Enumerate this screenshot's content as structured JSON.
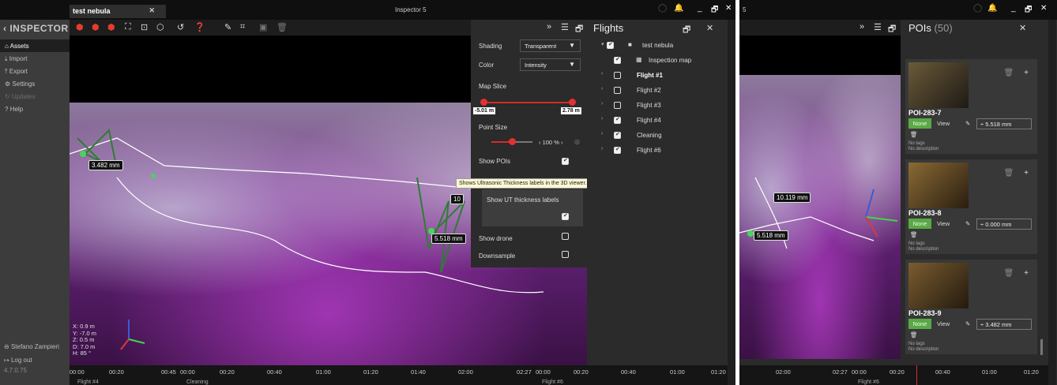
{
  "left_window": {
    "tab": "test nebula",
    "title": "Inspector 5",
    "sidebar": {
      "logo": "INSPECTOR",
      "items": [
        {
          "label": "Assets",
          "icon": "home-icon",
          "active": true
        },
        {
          "label": "Import",
          "icon": "download-icon"
        },
        {
          "label": "Export",
          "icon": "upload-icon"
        },
        {
          "label": "Settings",
          "icon": "gear-icon"
        },
        {
          "label": "Updates",
          "icon": "refresh-icon",
          "dim": true
        },
        {
          "label": "Help",
          "icon": "help-icon"
        }
      ],
      "user": "Stefano Zampieri",
      "logout": "Log out",
      "version": "4.7.0.75"
    },
    "settings_panel": {
      "shading_label": "Shading",
      "shading_value": "Transparent",
      "color_label": "Color",
      "color_value": "Intensity",
      "map_slice_label": "Map Slice",
      "map_slice_min": "-5.01 m",
      "map_slice_max": "2.78 m",
      "point_size_label": "Point Size",
      "point_size_value": "100 %",
      "show_pois_label": "Show POIs",
      "show_pois": true,
      "tooltip": "Shows Ultrasonic Thickness labels in the 3D viewer.",
      "show_ut_label": "Show UT thickness labels",
      "show_ut": true,
      "show_drone_label": "Show drone",
      "show_drone": false,
      "downsample_label": "Downsample",
      "downsample": false
    },
    "flights": {
      "title": "Flights",
      "items": [
        {
          "label": "test nebula",
          "checked": true,
          "bold": false
        },
        {
          "label": "Inspection map",
          "checked": true,
          "bold": false
        },
        {
          "label": "Flight #1",
          "checked": false,
          "bold": true
        },
        {
          "label": "Flight #2",
          "checked": false,
          "bold": false
        },
        {
          "label": "Flight #3",
          "checked": false,
          "bold": false
        },
        {
          "label": "Flight #4",
          "checked": true,
          "bold": false
        },
        {
          "label": "Cleaning",
          "checked": true,
          "bold": false
        },
        {
          "label": "Flight #6",
          "checked": true,
          "bold": false
        }
      ]
    },
    "viewport_labels": [
      "3.482 mm",
      "5.518 mm",
      "10"
    ],
    "coords": {
      "x": "X:  0.9 m",
      "y": "Y:  -7.0 m",
      "z": "Z:  0.5 m",
      "d": "D:  7.0 m",
      "h": "H:   85 °"
    },
    "timeline": {
      "ticks": [
        "00:00",
        "00:20",
        "00:45",
        "00:00",
        "00:20",
        "00:40",
        "01:00",
        "01:20",
        "01:40",
        "02:00",
        "02:27",
        "00:00",
        "00:20",
        "00:40",
        "01:00",
        "01:20"
      ],
      "segments": [
        "Flight #4",
        "Cleaning",
        "Flight #6"
      ]
    }
  },
  "right_window": {
    "title_fragment": "5",
    "panel_title": "POIs",
    "poi_count": "(50)",
    "viewport_labels": [
      "10.119 mm",
      "5.518 mm"
    ],
    "pois": [
      {
        "name": "POI-283-7",
        "badge": "None",
        "view": "View",
        "thickness": "5.518 mm",
        "tags": "No tags",
        "desc": "No description"
      },
      {
        "name": "POI-283-8",
        "badge": "None",
        "view": "View",
        "thickness": "0.000 mm",
        "tags": "No tags",
        "desc": "No description"
      },
      {
        "name": "POI-283-9",
        "badge": "None",
        "view": "View",
        "thickness": "3.482 mm",
        "tags": "No tags",
        "desc": "No description"
      }
    ],
    "timeline": {
      "ticks": [
        "02:00",
        "02:27",
        "00:00",
        "00:20",
        "00:40",
        "01:00",
        "01:20"
      ],
      "segment": "Flight #6"
    }
  },
  "colors": {
    "accent_red": "#e53030",
    "accent_green": "#5aa847",
    "cloud_purple": "#7b3f8f"
  }
}
